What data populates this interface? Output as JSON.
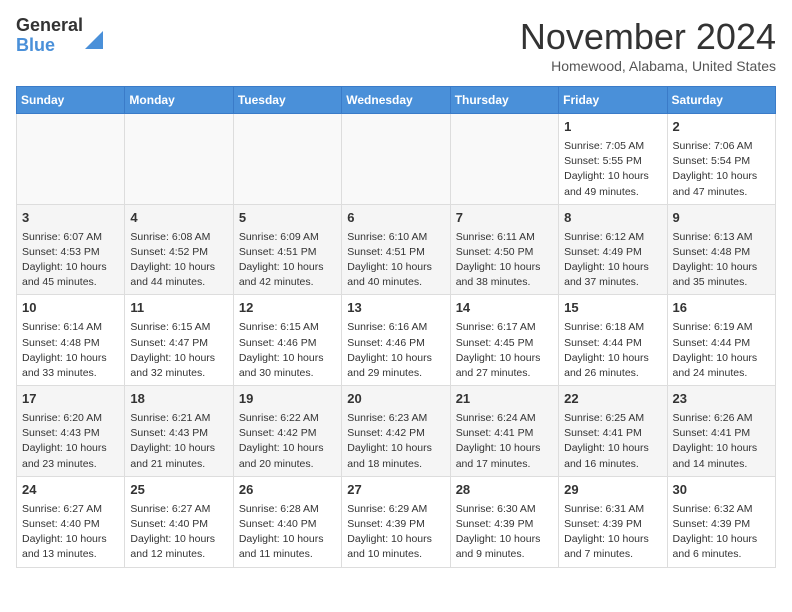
{
  "header": {
    "logo": {
      "line1": "General",
      "line2": "Blue"
    },
    "title": "November 2024",
    "location": "Homewood, Alabama, United States"
  },
  "weekdays": [
    "Sunday",
    "Monday",
    "Tuesday",
    "Wednesday",
    "Thursday",
    "Friday",
    "Saturday"
  ],
  "weeks": [
    [
      {
        "day": "",
        "info": ""
      },
      {
        "day": "",
        "info": ""
      },
      {
        "day": "",
        "info": ""
      },
      {
        "day": "",
        "info": ""
      },
      {
        "day": "",
        "info": ""
      },
      {
        "day": "1",
        "info": "Sunrise: 7:05 AM\nSunset: 5:55 PM\nDaylight: 10 hours\nand 49 minutes."
      },
      {
        "day": "2",
        "info": "Sunrise: 7:06 AM\nSunset: 5:54 PM\nDaylight: 10 hours\nand 47 minutes."
      }
    ],
    [
      {
        "day": "3",
        "info": "Sunrise: 6:07 AM\nSunset: 4:53 PM\nDaylight: 10 hours\nand 45 minutes."
      },
      {
        "day": "4",
        "info": "Sunrise: 6:08 AM\nSunset: 4:52 PM\nDaylight: 10 hours\nand 44 minutes."
      },
      {
        "day": "5",
        "info": "Sunrise: 6:09 AM\nSunset: 4:51 PM\nDaylight: 10 hours\nand 42 minutes."
      },
      {
        "day": "6",
        "info": "Sunrise: 6:10 AM\nSunset: 4:51 PM\nDaylight: 10 hours\nand 40 minutes."
      },
      {
        "day": "7",
        "info": "Sunrise: 6:11 AM\nSunset: 4:50 PM\nDaylight: 10 hours\nand 38 minutes."
      },
      {
        "day": "8",
        "info": "Sunrise: 6:12 AM\nSunset: 4:49 PM\nDaylight: 10 hours\nand 37 minutes."
      },
      {
        "day": "9",
        "info": "Sunrise: 6:13 AM\nSunset: 4:48 PM\nDaylight: 10 hours\nand 35 minutes."
      }
    ],
    [
      {
        "day": "10",
        "info": "Sunrise: 6:14 AM\nSunset: 4:48 PM\nDaylight: 10 hours\nand 33 minutes."
      },
      {
        "day": "11",
        "info": "Sunrise: 6:15 AM\nSunset: 4:47 PM\nDaylight: 10 hours\nand 32 minutes."
      },
      {
        "day": "12",
        "info": "Sunrise: 6:15 AM\nSunset: 4:46 PM\nDaylight: 10 hours\nand 30 minutes."
      },
      {
        "day": "13",
        "info": "Sunrise: 6:16 AM\nSunset: 4:46 PM\nDaylight: 10 hours\nand 29 minutes."
      },
      {
        "day": "14",
        "info": "Sunrise: 6:17 AM\nSunset: 4:45 PM\nDaylight: 10 hours\nand 27 minutes."
      },
      {
        "day": "15",
        "info": "Sunrise: 6:18 AM\nSunset: 4:44 PM\nDaylight: 10 hours\nand 26 minutes."
      },
      {
        "day": "16",
        "info": "Sunrise: 6:19 AM\nSunset: 4:44 PM\nDaylight: 10 hours\nand 24 minutes."
      }
    ],
    [
      {
        "day": "17",
        "info": "Sunrise: 6:20 AM\nSunset: 4:43 PM\nDaylight: 10 hours\nand 23 minutes."
      },
      {
        "day": "18",
        "info": "Sunrise: 6:21 AM\nSunset: 4:43 PM\nDaylight: 10 hours\nand 21 minutes."
      },
      {
        "day": "19",
        "info": "Sunrise: 6:22 AM\nSunset: 4:42 PM\nDaylight: 10 hours\nand 20 minutes."
      },
      {
        "day": "20",
        "info": "Sunrise: 6:23 AM\nSunset: 4:42 PM\nDaylight: 10 hours\nand 18 minutes."
      },
      {
        "day": "21",
        "info": "Sunrise: 6:24 AM\nSunset: 4:41 PM\nDaylight: 10 hours\nand 17 minutes."
      },
      {
        "day": "22",
        "info": "Sunrise: 6:25 AM\nSunset: 4:41 PM\nDaylight: 10 hours\nand 16 minutes."
      },
      {
        "day": "23",
        "info": "Sunrise: 6:26 AM\nSunset: 4:41 PM\nDaylight: 10 hours\nand 14 minutes."
      }
    ],
    [
      {
        "day": "24",
        "info": "Sunrise: 6:27 AM\nSunset: 4:40 PM\nDaylight: 10 hours\nand 13 minutes."
      },
      {
        "day": "25",
        "info": "Sunrise: 6:27 AM\nSunset: 4:40 PM\nDaylight: 10 hours\nand 12 minutes."
      },
      {
        "day": "26",
        "info": "Sunrise: 6:28 AM\nSunset: 4:40 PM\nDaylight: 10 hours\nand 11 minutes."
      },
      {
        "day": "27",
        "info": "Sunrise: 6:29 AM\nSunset: 4:39 PM\nDaylight: 10 hours\nand 10 minutes."
      },
      {
        "day": "28",
        "info": "Sunrise: 6:30 AM\nSunset: 4:39 PM\nDaylight: 10 hours\nand 9 minutes."
      },
      {
        "day": "29",
        "info": "Sunrise: 6:31 AM\nSunset: 4:39 PM\nDaylight: 10 hours\nand 7 minutes."
      },
      {
        "day": "30",
        "info": "Sunrise: 6:32 AM\nSunset: 4:39 PM\nDaylight: 10 hours\nand 6 minutes."
      }
    ]
  ]
}
